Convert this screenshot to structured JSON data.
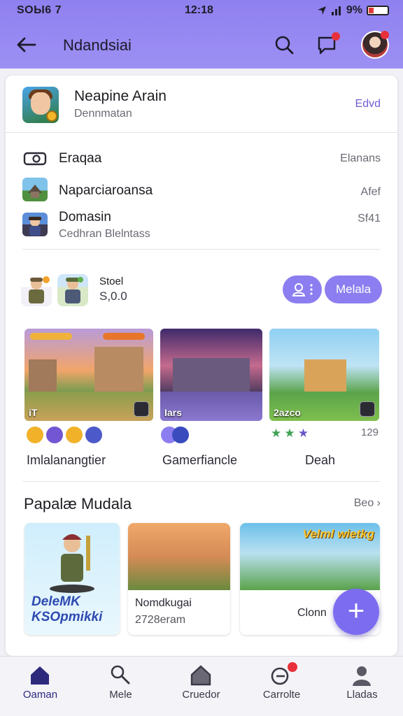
{
  "status_bar": {
    "left": "SOЫ6 7",
    "time": "12:18",
    "battery": "9%"
  },
  "app_bar": {
    "title": "Ndandsiai",
    "icons": [
      "back-arrow-icon",
      "search-icon",
      "chat-icon",
      "avatar"
    ]
  },
  "profile": {
    "name": "Neapine Arain",
    "subtitle": "Dennmatan",
    "action": "Edvd"
  },
  "list": [
    {
      "icon": "toggle-icon",
      "title": "Eraqaa",
      "value": "Elanans"
    },
    {
      "icon": "house-thumb",
      "title": "Naparciaroansa",
      "value": "Afef"
    },
    {
      "icon": "game-thumb",
      "title": "Domasin",
      "subtitle": "Cedhran Blelntass",
      "value": "Sf41"
    }
  ],
  "collection": {
    "label": "Stoel",
    "value": "S,0.0",
    "button": "Melala"
  },
  "games": [
    {
      "name": "Imlalanangtier",
      "tag": "iT",
      "badges": [
        "#f1b22a",
        "#7356d3",
        "#f1b22a",
        "#4c5ac9"
      ]
    },
    {
      "name": "Gamerfiancle",
      "tag": "Iars",
      "badges": [
        "#8c7ef0",
        "#3a4bbd"
      ]
    },
    {
      "name": "Deah",
      "tag": "2azco",
      "rating_count": "129"
    }
  ],
  "featured": {
    "title": "Papalæ Mudala",
    "see_all": "Beo",
    "items": [
      {
        "text": "DeleMK KSOpmikki"
      },
      {
        "title": "Nomdkugai",
        "subtitle": "2728eram"
      },
      {
        "banner": "Velml wietkg",
        "title": "Clonn"
      }
    ]
  },
  "bottom_nav": [
    {
      "label": "Oaman",
      "icon": "home-icon",
      "active": true
    },
    {
      "label": "Mele",
      "icon": "search-tag-icon",
      "active": false
    },
    {
      "label": "Cruedor",
      "icon": "house-outline-icon",
      "active": false
    },
    {
      "label": "Carrolte",
      "icon": "cart-icon",
      "active": false,
      "badge": "!"
    },
    {
      "label": "Lladas",
      "icon": "person-icon",
      "active": false
    }
  ],
  "colors": {
    "accent": "#8c7ef0",
    "header": "#9587f1",
    "fab": "#7c6cf0"
  }
}
